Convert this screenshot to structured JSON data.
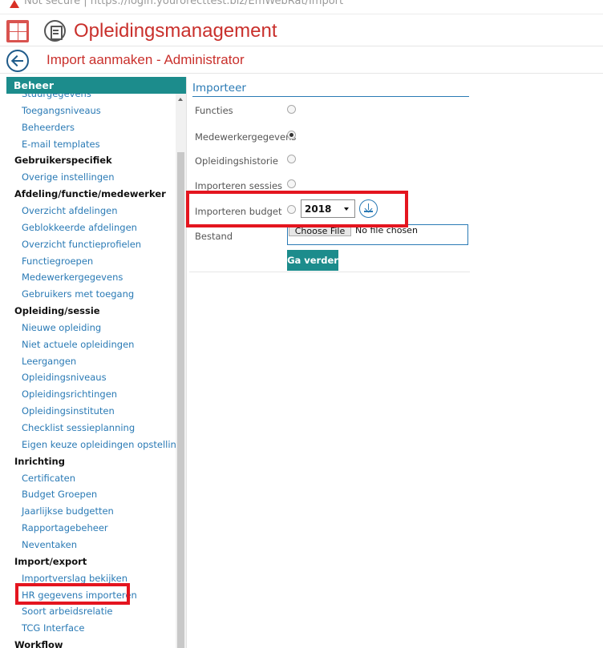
{
  "browser": {
    "url_text": "Not secure | https://login.yourorecttest.biz/EmWebRat/Import"
  },
  "app": {
    "title": "Opleidingsmanagement"
  },
  "page": {
    "title": "Import aanmaken - Administrator"
  },
  "sidebar": {
    "header": "Beheer",
    "rows": [
      {
        "type": "link",
        "label": "Stuurgegevens"
      },
      {
        "type": "link",
        "label": "Toegangsniveaus"
      },
      {
        "type": "link",
        "label": "Beheerders"
      },
      {
        "type": "link",
        "label": "E-mail templates"
      },
      {
        "type": "section",
        "label": "Gebruikerspecifiek"
      },
      {
        "type": "link",
        "label": "Overige instellingen"
      },
      {
        "type": "section",
        "label": "Afdeling/functie/medewerker"
      },
      {
        "type": "link",
        "label": "Overzicht afdelingen"
      },
      {
        "type": "link",
        "label": "Geblokkeerde afdelingen"
      },
      {
        "type": "link",
        "label": "Overzicht functieprofielen"
      },
      {
        "type": "link",
        "label": "Functiegroepen"
      },
      {
        "type": "link",
        "label": "Medewerkergegevens"
      },
      {
        "type": "link",
        "label": "Gebruikers met toegang"
      },
      {
        "type": "section",
        "label": "Opleiding/sessie"
      },
      {
        "type": "link",
        "label": "Nieuwe opleiding"
      },
      {
        "type": "link",
        "label": "Niet actuele opleidingen"
      },
      {
        "type": "link",
        "label": "Leergangen"
      },
      {
        "type": "link",
        "label": "Opleidingsniveaus"
      },
      {
        "type": "link",
        "label": "Opleidingsrichtingen"
      },
      {
        "type": "link",
        "label": "Opleidingsinstituten"
      },
      {
        "type": "link",
        "label": "Checklist sessieplanning"
      },
      {
        "type": "link",
        "label": "Eigen keuze opleidingen opstelling"
      },
      {
        "type": "section",
        "label": "Inrichting"
      },
      {
        "type": "link",
        "label": "Certificaten"
      },
      {
        "type": "link",
        "label": "Budget Groepen"
      },
      {
        "type": "link",
        "label": "Jaarlijkse budgetten"
      },
      {
        "type": "link",
        "label": "Rapportagebeheer"
      },
      {
        "type": "link",
        "label": "Neventaken"
      },
      {
        "type": "section",
        "label": "Import/export"
      },
      {
        "type": "link",
        "label": "Importverslag bekijken"
      },
      {
        "type": "link",
        "label": "HR gegevens importeren"
      },
      {
        "type": "link",
        "label": "Soort arbeidsrelatie"
      },
      {
        "type": "link",
        "label": "TCG Interface"
      },
      {
        "type": "section",
        "label": "Workflow"
      }
    ]
  },
  "main": {
    "section_title": "Importeer",
    "options": [
      {
        "label": "Functies",
        "selected": false
      },
      {
        "label": "Medewerkergegevens",
        "selected": true
      },
      {
        "label": "Opleidingshistorie",
        "selected": false
      },
      {
        "label": "Importeren sessies",
        "selected": false
      },
      {
        "label": "Importeren budget",
        "selected": false
      }
    ],
    "year_select": "2018",
    "file_label": "Bestand",
    "file_button": "Choose File",
    "file_status": "No file chosen",
    "submit": "Ga verder"
  },
  "icons": {
    "grid": "grid-icon",
    "app": "document-icon",
    "back": "back-arrow-icon",
    "download": "download-icon",
    "warning": "warning-icon"
  },
  "colors": {
    "brand_red": "#c9302c",
    "teal": "#1c8c8c",
    "link_blue": "#2a7ab5",
    "annotation_red": "#e4151f"
  }
}
